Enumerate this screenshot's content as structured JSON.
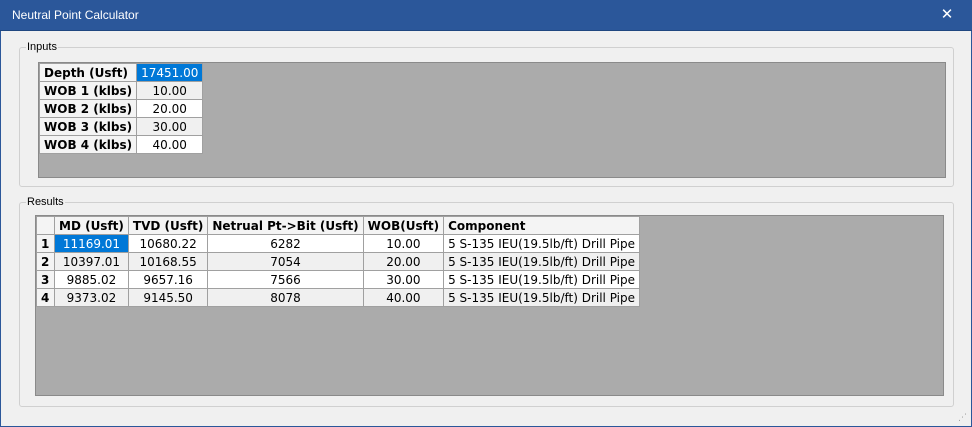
{
  "window": {
    "title": "Neutral Point Calculator"
  },
  "inputs": {
    "legend": "Inputs",
    "rows": [
      {
        "label": "Depth (Usft)",
        "value": "17451.00"
      },
      {
        "label": "WOB 1 (klbs)",
        "value": "10.00"
      },
      {
        "label": "WOB 2 (klbs)",
        "value": "20.00"
      },
      {
        "label": "WOB 3 (klbs)",
        "value": "30.00"
      },
      {
        "label": "WOB 4 (klbs)",
        "value": "40.00"
      }
    ]
  },
  "results": {
    "legend": "Results",
    "columns": [
      "MD (Usft)",
      "TVD (Usft)",
      "Netrual Pt->Bit (Usft)",
      "WOB(Usft)",
      "Component"
    ],
    "rows": [
      {
        "index": "1",
        "md": "11169.01",
        "tvd": "10680.22",
        "np": "6282",
        "wob": "10.00",
        "component": "5 S-135 IEU(19.5lb/ft) Drill Pipe"
      },
      {
        "index": "2",
        "md": "10397.01",
        "tvd": "10168.55",
        "np": "7054",
        "wob": "20.00",
        "component": "5 S-135 IEU(19.5lb/ft) Drill Pipe"
      },
      {
        "index": "3",
        "md": "9885.02",
        "tvd": "9657.16",
        "np": "7566",
        "wob": "30.00",
        "component": "5 S-135 IEU(19.5lb/ft) Drill Pipe"
      },
      {
        "index": "4",
        "md": "9373.02",
        "tvd": "9145.50",
        "np": "8078",
        "wob": "40.00",
        "component": "5 S-135 IEU(19.5lb/ft) Drill Pipe"
      }
    ]
  },
  "icons": {
    "close": "close-icon",
    "resize": "resize-grip-icon"
  },
  "colors": {
    "titlebar": "#2b579a",
    "selection": "#0078d7",
    "grid_background": "#ababab"
  }
}
